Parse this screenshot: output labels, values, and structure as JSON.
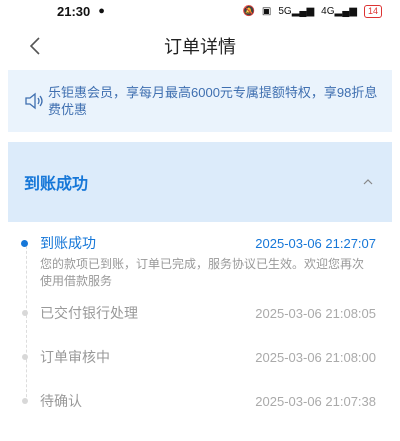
{
  "status_bar": {
    "time": "21:30",
    "signal_text": "5G",
    "signal_text2": "4G",
    "battery": "14"
  },
  "header": {
    "title": "订单详情"
  },
  "banner": {
    "text": "乐钜惠会员，享每月最高6000元专属提额特权，享98折息费优惠"
  },
  "section": {
    "title": "到账成功"
  },
  "timeline": [
    {
      "name": "到账成功",
      "time": "2025-03-06 21:27:07",
      "desc": "您的款项已到账，订单已完成，服务协议已生效。欢迎您再次使用借款服务"
    },
    {
      "name": "已交付银行处理",
      "time": "2025-03-06 21:08:05"
    },
    {
      "name": "订单审核中",
      "time": "2025-03-06 21:08:00"
    },
    {
      "name": "待确认",
      "time": "2025-03-06 21:07:38"
    }
  ],
  "colors": {
    "accent": "#1677d8",
    "banner_bg": "#eaf3fc",
    "section_bg": "#dcebfa"
  }
}
